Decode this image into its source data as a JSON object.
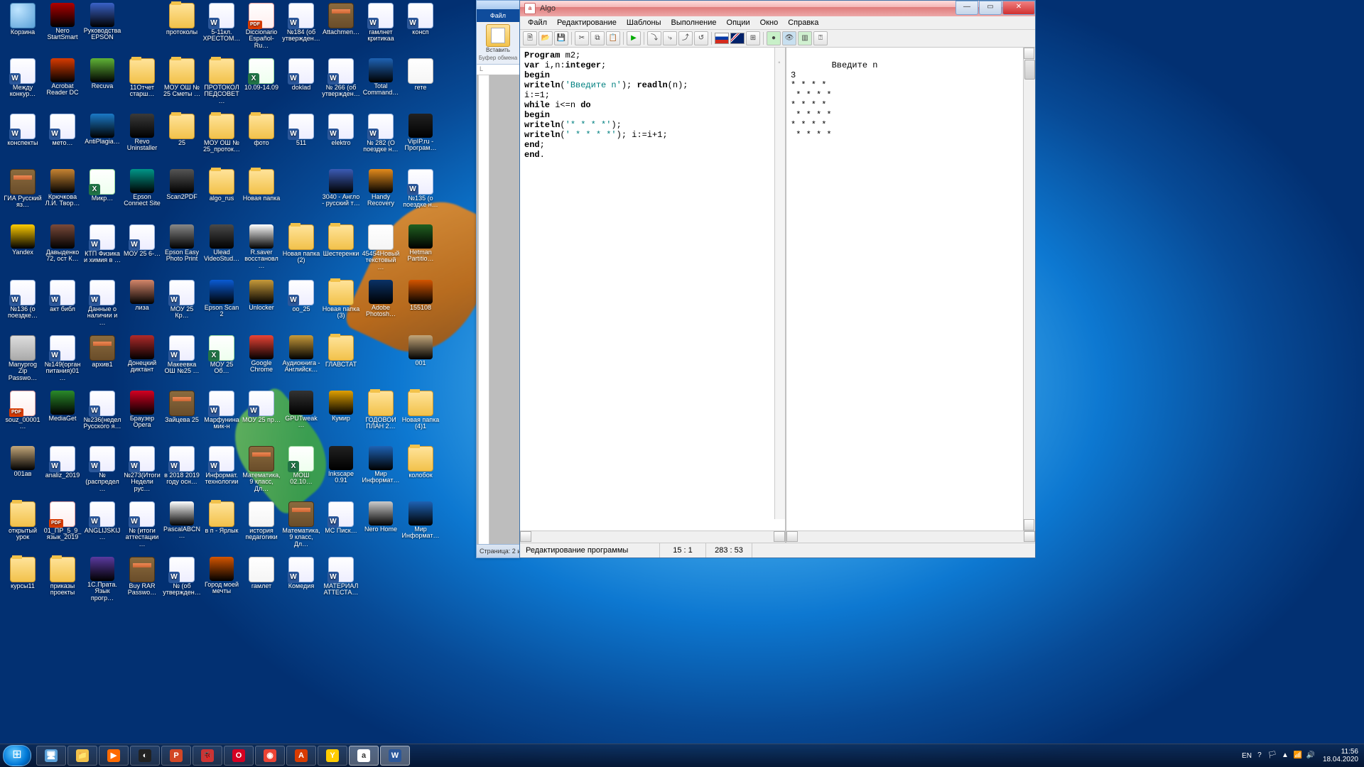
{
  "word": {
    "tab": "Файл",
    "paste": "Вставить",
    "group": "Буфер обмена",
    "status": "Страница: 2 и"
  },
  "algo": {
    "title": "Algo",
    "menu": [
      "Файл",
      "Редактирование",
      "Шаблоны",
      "Выполнение",
      "Опции",
      "Окно",
      "Справка"
    ],
    "status_label": "Редактирование программы",
    "cursor1": "15 :  1",
    "cursor2": "283 : 53",
    "code_plain": "Program m2;\nvar i,n:integer;\nbegin\nwriteln('Введите n'); readln(n);\ni:=1;\nwhile i<=n do\nbegin\nwriteln('* * * *');\nwriteln(' * * * *'); i:=i+1;\nend;\nend.",
    "output": "Введите n\n3\n* * * *\n * * * *\n* * * *\n * * * *\n* * * *\n * * * *"
  },
  "tray": {
    "lang": "EN",
    "time": "11:56",
    "date": "18.04.2020"
  },
  "desktop_icons": [
    {
      "l": "Корзина",
      "t": "bin"
    },
    {
      "l": "Nero StartSmart",
      "t": "app",
      "c": "#b00000"
    },
    {
      "l": "Руководства EPSON",
      "t": "app",
      "c": "#3a62c8"
    },
    {
      "l": "",
      "t": ""
    },
    {
      "l": "протоколы",
      "t": "folder"
    },
    {
      "l": "5-11кл. ХРЕСТОМ…",
      "t": "doc"
    },
    {
      "l": "Diccionario Español-Ru…",
      "t": "pdf"
    },
    {
      "l": "№184 (об утвержден…",
      "t": "doc"
    },
    {
      "l": "Attachmen…",
      "t": "rar"
    },
    {
      "l": "гамлнет критикаа",
      "t": "doc"
    },
    {
      "l": "консп",
      "t": "doc"
    },
    {
      "l": "Между конкур…",
      "t": "doc"
    },
    {
      "l": "Acrobat Reader DC",
      "t": "app",
      "c": "#d83b01"
    },
    {
      "l": "Recuva",
      "t": "app",
      "c": "#5fb336"
    },
    {
      "l": "11Отчет старш…",
      "t": "folder"
    },
    {
      "l": "МОУ ОШ № 25 Сметы …",
      "t": "folder"
    },
    {
      "l": "ПРОТОКОЛ ПЕДСОВЕТ…",
      "t": "folder"
    },
    {
      "l": "10.09-14.09",
      "t": "xls"
    },
    {
      "l": "doklad",
      "t": "doc"
    },
    {
      "l": "№ 266 (об утвержден…",
      "t": "doc"
    },
    {
      "l": "Total Command…",
      "t": "app",
      "c": "#1e62b4"
    },
    {
      "l": "гете",
      "t": "txt"
    },
    {
      "l": "конспекты",
      "t": "doc"
    },
    {
      "l": "мето…",
      "t": "doc"
    },
    {
      "l": "AntiPlagia…",
      "t": "app",
      "c": "#1b79c7"
    },
    {
      "l": "Revo Uninstaller",
      "t": "app",
      "c": "#3a3a3a"
    },
    {
      "l": "25",
      "t": "folder"
    },
    {
      "l": "МОУ ОШ № 25_проток…",
      "t": "folder"
    },
    {
      "l": "фото",
      "t": "folder"
    },
    {
      "l": "511",
      "t": "doc"
    },
    {
      "l": "elektro",
      "t": "doc"
    },
    {
      "l": "№ 282 (О поездке н…",
      "t": "doc"
    },
    {
      "l": "VipIP.ru - Програм…",
      "t": "app",
      "c": "#222"
    },
    {
      "l": "ГИА Русский яз…",
      "t": "rar"
    },
    {
      "l": "Крючкова Л.И. Твор…",
      "t": "app",
      "c": "#c78432"
    },
    {
      "l": "Микр…",
      "t": "xls"
    },
    {
      "l": "Epson Connect Site",
      "t": "app",
      "c": "#009688"
    },
    {
      "l": "Scan2PDF",
      "t": "app",
      "c": "#555"
    },
    {
      "l": "algo_rus",
      "t": "folder"
    },
    {
      "l": "Новая папка",
      "t": "folder"
    },
    {
      "l": "",
      "t": ""
    },
    {
      "l": "3040 - Англо - русский т…",
      "t": "app",
      "c": "#3b5bb5"
    },
    {
      "l": "Handy Recovery",
      "t": "app",
      "c": "#e38b1c"
    },
    {
      "l": "№135 (о поездке н…",
      "t": "doc"
    },
    {
      "l": "Yandex",
      "t": "app",
      "c": "#ffcc00"
    },
    {
      "l": "Давыденко 72, ост К…",
      "t": "app",
      "c": "#7a4a3a"
    },
    {
      "l": "КТП Физика и химия в …",
      "t": "doc"
    },
    {
      "l": "МОУ 25 6-…",
      "t": "doc"
    },
    {
      "l": "Epson Easy Photo Print",
      "t": "app",
      "c": "#888"
    },
    {
      "l": "Ulead VideoStud…",
      "t": "app",
      "c": "#4a4a4a"
    },
    {
      "l": "R.saver восстановл…",
      "t": "app",
      "c": "#fff"
    },
    {
      "l": "Новая папка (2)",
      "t": "folder"
    },
    {
      "l": "Шестеренки",
      "t": "folder"
    },
    {
      "l": "45454Новый текстовый …",
      "t": "txt"
    },
    {
      "l": "Hetman Partitio…",
      "t": "app",
      "c": "#206020"
    },
    {
      "l": "№136 (о поездке…",
      "t": "doc"
    },
    {
      "l": "акт библ",
      "t": "doc"
    },
    {
      "l": "Данные о наличии и …",
      "t": "doc"
    },
    {
      "l": "лиза",
      "t": "app",
      "c": "#d4866a"
    },
    {
      "l": "МОУ 25 Кр…",
      "t": "doc"
    },
    {
      "l": "Epson Scan 2",
      "t": "app",
      "c": "#0a5bd4"
    },
    {
      "l": "Unlocker",
      "t": "app",
      "c": "#c79a3a"
    },
    {
      "l": "оо_25",
      "t": "doc"
    },
    {
      "l": "Новая папка (3)",
      "t": "folder"
    },
    {
      "l": "Adobe Photosh…",
      "t": "app",
      "c": "#0a3266"
    },
    {
      "l": "155108",
      "t": "app",
      "c": "#d45500"
    },
    {
      "l": "Manyprog Zip Passwo…",
      "t": "exe"
    },
    {
      "l": "№149(орган питания)01…",
      "t": "doc"
    },
    {
      "l": "архив1",
      "t": "rar"
    },
    {
      "l": "Донецкий диктант",
      "t": "app",
      "c": "#b02a2a"
    },
    {
      "l": "Макеевка ОШ №25 …",
      "t": "doc"
    },
    {
      "l": "МОУ 25 Об…",
      "t": "xls"
    },
    {
      "l": "Google Chrome",
      "t": "app",
      "c": "#ea4335"
    },
    {
      "l": "Аудиокнига - Английск…",
      "t": "app",
      "c": "#c79a3a"
    },
    {
      "l": "ГЛАВСТАТ",
      "t": "folder"
    },
    {
      "l": "",
      "t": ""
    },
    {
      "l": "001",
      "t": "app",
      "c": "#c4a77a"
    },
    {
      "l": "souz_00001…",
      "t": "pdf"
    },
    {
      "l": "MediaGet",
      "t": "app",
      "c": "#2a8a2a"
    },
    {
      "l": "№236(недел Русского я…",
      "t": "doc"
    },
    {
      "l": "Браузер Opera",
      "t": "app",
      "c": "#d40022"
    },
    {
      "l": "Зайцева 25",
      "t": "rar"
    },
    {
      "l": "Марфунина мик-н",
      "t": "doc"
    },
    {
      "l": "МОУ 25 пр…",
      "t": "doc"
    },
    {
      "l": "GPUTweak…",
      "t": "app",
      "c": "#333"
    },
    {
      "l": "Кумир",
      "t": "app",
      "c": "#e0a000"
    },
    {
      "l": "ГОДОВОЙ ПЛАН 2…",
      "t": "folder"
    },
    {
      "l": "Новая папка (4)1",
      "t": "folder"
    },
    {
      "l": "001ав",
      "t": "app",
      "c": "#c4a77a"
    },
    {
      "l": "analiz_2019",
      "t": "doc"
    },
    {
      "l": "№ (распредел…",
      "t": "doc"
    },
    {
      "l": "№273(Итоги Недели рус…",
      "t": "doc"
    },
    {
      "l": "в 2018 2019 году осн…",
      "t": "doc"
    },
    {
      "l": "Информат. технологии",
      "t": "doc"
    },
    {
      "l": "Математика, 9 класс, Дл…",
      "t": "rar"
    },
    {
      "l": "МОШ 02.10…",
      "t": "xls"
    },
    {
      "l": "Inkscape 0.91",
      "t": "app",
      "c": "#222"
    },
    {
      "l": "Мир Информат…",
      "t": "app",
      "c": "#1e62b4"
    },
    {
      "l": "колобок",
      "t": "folder"
    },
    {
      "l": "открытый урок",
      "t": "folder"
    },
    {
      "l": "01_ПР_5_9_язык_2019",
      "t": "pdf"
    },
    {
      "l": "ANGLIJSKIJ…",
      "t": "doc"
    },
    {
      "l": "№ (итоги аттестации…",
      "t": "doc"
    },
    {
      "l": "PascalABCN…",
      "t": "app",
      "c": "#fff"
    },
    {
      "l": "в п - Ярлык",
      "t": "folder"
    },
    {
      "l": "история педагогики",
      "t": "txt"
    },
    {
      "l": "Математика, 9 класс, Дл…",
      "t": "rar"
    },
    {
      "l": "МС Писк…",
      "t": "doc"
    },
    {
      "l": "Nero Home",
      "t": "app",
      "c": "#ccc"
    },
    {
      "l": "Мир Информат…",
      "t": "app",
      "c": "#1e62b4"
    },
    {
      "l": "курсы11",
      "t": "folder"
    },
    {
      "l": "приказы проекты",
      "t": "folder"
    },
    {
      "l": "1С.Прата. Язык прогр…",
      "t": "app",
      "c": "#5a3aa0"
    },
    {
      "l": "Buy RAR Passwo…",
      "t": "rar"
    },
    {
      "l": "№ (об утвержден…",
      "t": "doc"
    },
    {
      "l": "Город моей мечты",
      "t": "app",
      "c": "#d45500"
    },
    {
      "l": "гамлет",
      "t": "txt"
    },
    {
      "l": "Комедия",
      "t": "doc"
    },
    {
      "l": "МАТЕРИАЛ АТТЕСТА…",
      "t": "doc"
    },
    {
      "l": "",
      "t": ""
    }
  ],
  "taskbar_icons": [
    {
      "g": "🖥",
      "c": "#5aa0d8"
    },
    {
      "g": "📁",
      "c": "#f2c24b"
    },
    {
      "g": "▶",
      "c": "#ff6a00"
    },
    {
      "g": "◐",
      "c": "#222"
    },
    {
      "g": "P",
      "c": "#d24726"
    },
    {
      "g": "🐞",
      "c": "#c33"
    },
    {
      "g": "O",
      "c": "#d40022"
    },
    {
      "g": "◉",
      "c": "#ea4335"
    },
    {
      "g": "A",
      "c": "#d83b01"
    },
    {
      "g": "Y",
      "c": "#ffcc00"
    },
    {
      "g": "a",
      "c": "#fff",
      "active": true
    },
    {
      "g": "W",
      "c": "#2b579a",
      "active": true
    }
  ]
}
